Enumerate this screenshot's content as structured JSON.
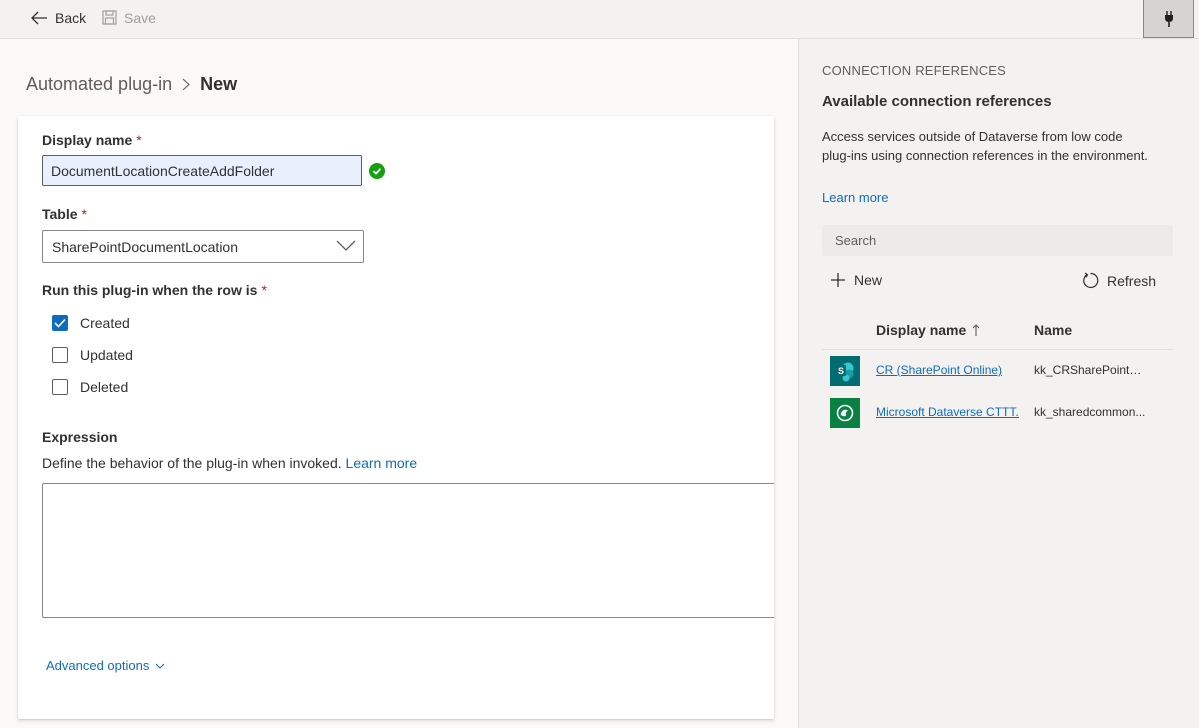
{
  "toolbar": {
    "back_label": "Back",
    "save_label": "Save",
    "plug_icon": "plug-icon"
  },
  "breadcrumb": {
    "parent": "Automated plug-in",
    "current": "New"
  },
  "form": {
    "display_name": {
      "label": "Display name",
      "required_mark": "*",
      "value": "DocumentLocationCreateAddFolder",
      "status": "valid"
    },
    "table": {
      "label": "Table",
      "required_mark": "*",
      "selected": "SharePointDocumentLocation"
    },
    "run_when": {
      "label": "Run this plug-in when the row is",
      "required_mark": "*",
      "options": [
        {
          "label": "Created",
          "checked": true
        },
        {
          "label": "Updated",
          "checked": false
        },
        {
          "label": "Deleted",
          "checked": false
        }
      ]
    },
    "expression": {
      "label": "Expression",
      "description": "Define the behavior of the plug-in when invoked.",
      "learn_more": "Learn more",
      "value": ""
    },
    "advanced_options": "Advanced options"
  },
  "panel": {
    "eyebrow": "CONNECTION REFERENCES",
    "title": "Available connection references",
    "description": "Access services outside of Dataverse from low code plug-ins using connection references in the environment.",
    "learn_more": "Learn more",
    "search_placeholder": "Search",
    "new_label": "New",
    "refresh_label": "Refresh",
    "columns": {
      "display_name": "Display name",
      "name": "Name"
    },
    "sort": {
      "column": "display_name",
      "direction": "ascending"
    },
    "rows": [
      {
        "icon": "sharepoint-icon",
        "icon_color": "#036c70",
        "display_name": "CR (SharePoint Online)",
        "name": "kk_CRSharePointO..."
      },
      {
        "icon": "dataverse-icon",
        "icon_color": "#088142",
        "display_name": "Microsoft Dataverse CTTT...",
        "name": "kk_sharedcommon..."
      }
    ]
  },
  "colors": {
    "accent": "#0f6cbd",
    "required": "#a4262c",
    "valid": "#13a10e",
    "checkbox_checked": "#0f6cbd"
  }
}
